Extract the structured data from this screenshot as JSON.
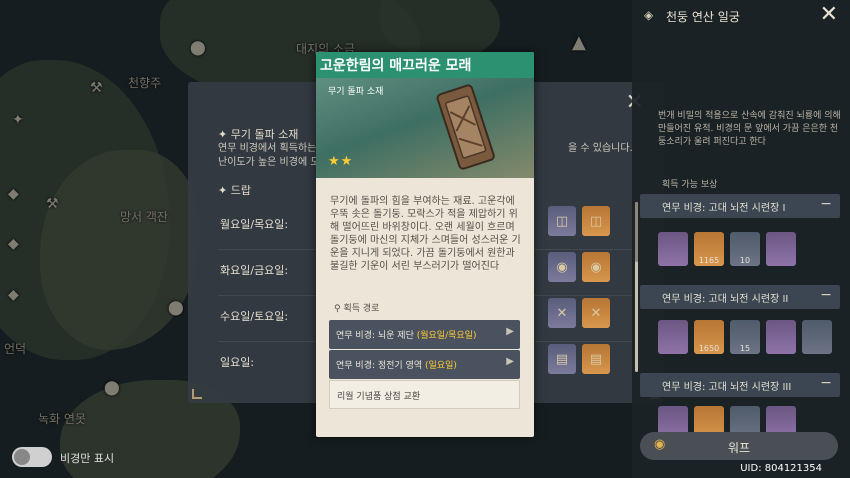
{
  "map": {
    "labels": {
      "top": "대지의 소금",
      "mountain": "천향주",
      "fort": "망서 객잔",
      "left": "언덕",
      "bottom": "녹화 연못"
    },
    "toggle_label": "비경만 표시"
  },
  "domain": {
    "section_material": "무기 돌파 소재",
    "desc_line1": "연무 비경에서 획득하는",
    "desc_tail": "을 수 있습니다.",
    "desc_line2": "난이도가 높은 비경에 도",
    "section_drop": "드랍",
    "days": [
      {
        "label": "월요일/목요일:"
      },
      {
        "label": "화요일/금요일:"
      },
      {
        "label": "수요일/토요일:"
      },
      {
        "label": "일요일:"
      }
    ]
  },
  "item": {
    "name": "고운한림의 매끄러운 모래",
    "category": "무기 돌파 소재",
    "rarity_stars": "★★",
    "description": "무기에 돌파의 힘을 부여하는 재료. 고운각에 우뚝 솟은 돌기둥. 모락스가 적을 제압하기 위해 떨어뜨린 바위창이다. 오랜 세월이 흐르며 돌기둥에 마신의 지체가 스며들어 성스러운 기운을 지니게 되었다. 가끔 돌기둥에서 원한과 불길한 기운이 서린 부스러기가 떨어진다",
    "source_header": "획득 경로",
    "sources": [
      {
        "text": "연무 비경: 뇌운 제단 ",
        "highlight": "(월요일/목요일)"
      },
      {
        "text": "연무 비경: 정전기 영역 ",
        "highlight": "(일요일)"
      }
    ],
    "source_plain": "리월 기념품 상점 교환"
  },
  "right_panel": {
    "title": "천둥 연산 일궁",
    "desc": "번개 비밀의 적용으로 산속에 감춰진 뇌룡에 의해 만들어진 유적. 비경의 문 앞에서 가끔 은은한 천둥소리가 울려 퍼진다고 한다",
    "rewards_label": "획득 가능 보상",
    "trials": [
      {
        "name": "연무 비경: 고대 뇌전 시련장 I",
        "counts": [
          "1165",
          "10"
        ]
      },
      {
        "name": "연무 비경: 고대 뇌전 시련장 II",
        "counts": [
          "1650",
          "15"
        ]
      },
      {
        "name": "연무 비경: 고대 뇌전 시련장 III"
      }
    ],
    "warp_label": "워프"
  },
  "uid": "UID: 804121354",
  "icons": [
    "close-icon",
    "compass-icon",
    "pin-icon",
    "arrow-right-icon",
    "star-icon",
    "gem-icon"
  ]
}
